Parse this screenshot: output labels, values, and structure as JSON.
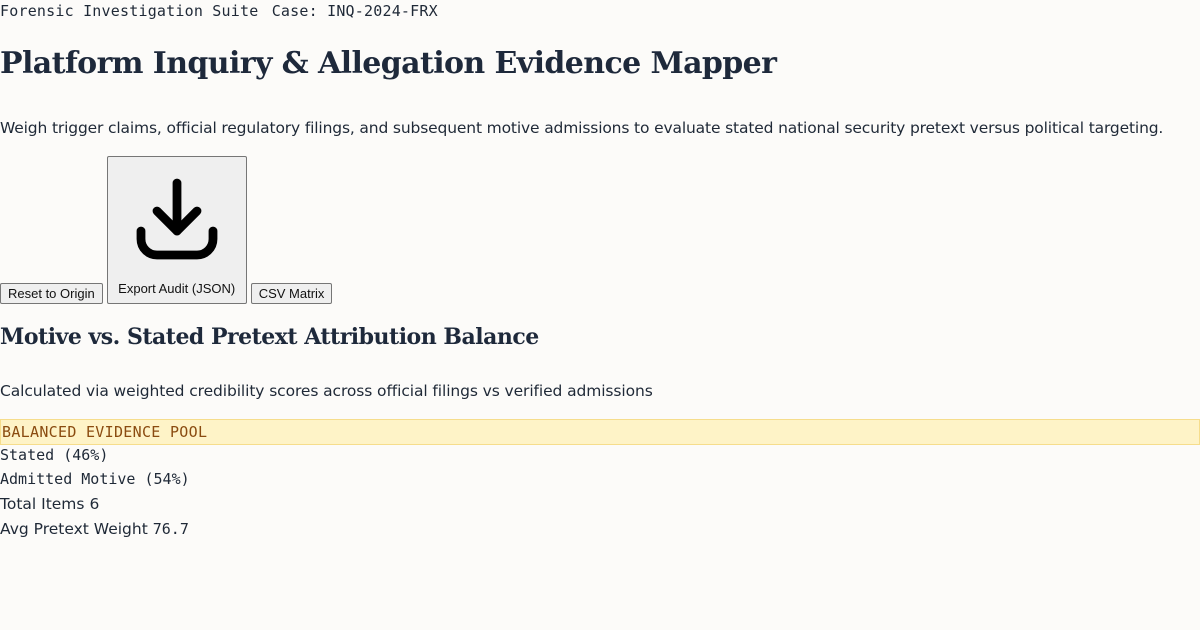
{
  "header": {
    "suite_label": "Forensic Investigation Suite",
    "case_label": "Case: INQ-2024-FRX"
  },
  "page": {
    "title": "Platform Inquiry & Allegation Evidence Mapper",
    "subtitle": "Weigh trigger claims, official regulatory filings, and subsequent motive admissions to evaluate stated national security pretext versus political targeting."
  },
  "actions": {
    "reset_label": "Reset to Origin",
    "export_label": "Export Audit (JSON)",
    "export_icon": "download-icon",
    "csv_label": "CSV Matrix"
  },
  "balance": {
    "title": "Motive vs. Stated Pretext Attribution Balance",
    "description": "Calculated via weighted credibility scores across official filings vs verified admissions",
    "status": "BALANCED EVIDENCE POOL",
    "stated_label": "Stated (46%)",
    "admitted_label": "Admitted Motive (54%)",
    "total_items_label": "Total Items",
    "total_items_value": "6",
    "avg_weight_label": "Avg Pretext Weight",
    "avg_weight_value": "76.7"
  },
  "colors": {
    "banner_bg": "#fef3c7",
    "banner_text": "#8a4b10",
    "heading": "#1e293b"
  }
}
